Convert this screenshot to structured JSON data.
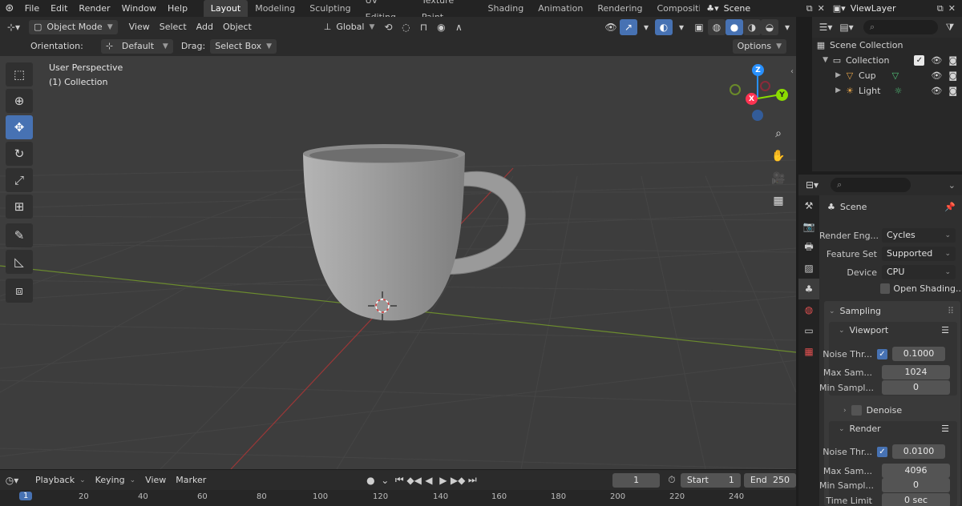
{
  "menubar": {
    "menus": [
      "File",
      "Edit",
      "Render",
      "Window",
      "Help"
    ],
    "workspaces": [
      "Layout",
      "Modeling",
      "Sculpting",
      "UV Editing",
      "Texture Paint",
      "Shading",
      "Animation",
      "Rendering",
      "Compositing"
    ],
    "active_workspace": "Layout",
    "scene_name": "Scene",
    "view_layer": "ViewLayer"
  },
  "viewport_header": {
    "mode": "Object Mode",
    "menus": [
      "View",
      "Select",
      "Add",
      "Object"
    ],
    "transform_orientation": "Global"
  },
  "tool_header": {
    "orientation_label": "Orientation:",
    "orientation_value": "Default",
    "drag_label": "Drag:",
    "drag_value": "Select Box",
    "options_label": "Options"
  },
  "viewport": {
    "perspective_label": "User Perspective",
    "collection_label": "(1) Collection",
    "gizmo_axes": [
      "Z",
      "Y",
      "X"
    ],
    "axis_colors": {
      "x": "#ff3352",
      "y": "#8bdc00",
      "z": "#2890ff"
    }
  },
  "outliner": {
    "root": "Scene Collection",
    "collection": "Collection",
    "objects": [
      {
        "name": "Cup",
        "icon": "mesh-icon"
      },
      {
        "name": "Light",
        "icon": "light-icon"
      }
    ]
  },
  "properties": {
    "context": "Scene",
    "render_engine_label": "Render Eng...",
    "render_engine": "Cycles",
    "feature_set_label": "Feature Set",
    "feature_set": "Supported",
    "device_label": "Device",
    "device": "CPU",
    "open_shading": "Open Shading...",
    "sampling": {
      "title": "Sampling",
      "viewport": {
        "title": "Viewport",
        "noise_threshold_label": "Noise Thr...",
        "noise_threshold": "0.1000",
        "max_samples_label": "Max Sam...",
        "max_samples": "1024",
        "min_samples_label": "Min Sampl...",
        "min_samples": "0"
      },
      "denoise": "Denoise",
      "render": {
        "title": "Render",
        "noise_threshold_label": "Noise Thr...",
        "noise_threshold": "0.0100",
        "max_samples_label": "Max Sam...",
        "max_samples": "4096",
        "min_samples_label": "Min Sampl...",
        "min_samples": "0",
        "time_limit_label": "Time Limit",
        "time_limit": "0 sec"
      }
    }
  },
  "timeline": {
    "menus": [
      "Playback",
      "Keying",
      "View",
      "Marker"
    ],
    "current_frame": "1",
    "start_label": "Start",
    "start": "1",
    "end_label": "End",
    "end": "250",
    "ruler": [
      "1",
      "20",
      "40",
      "60",
      "80",
      "100",
      "120",
      "140",
      "160",
      "180",
      "200",
      "220",
      "240"
    ]
  }
}
